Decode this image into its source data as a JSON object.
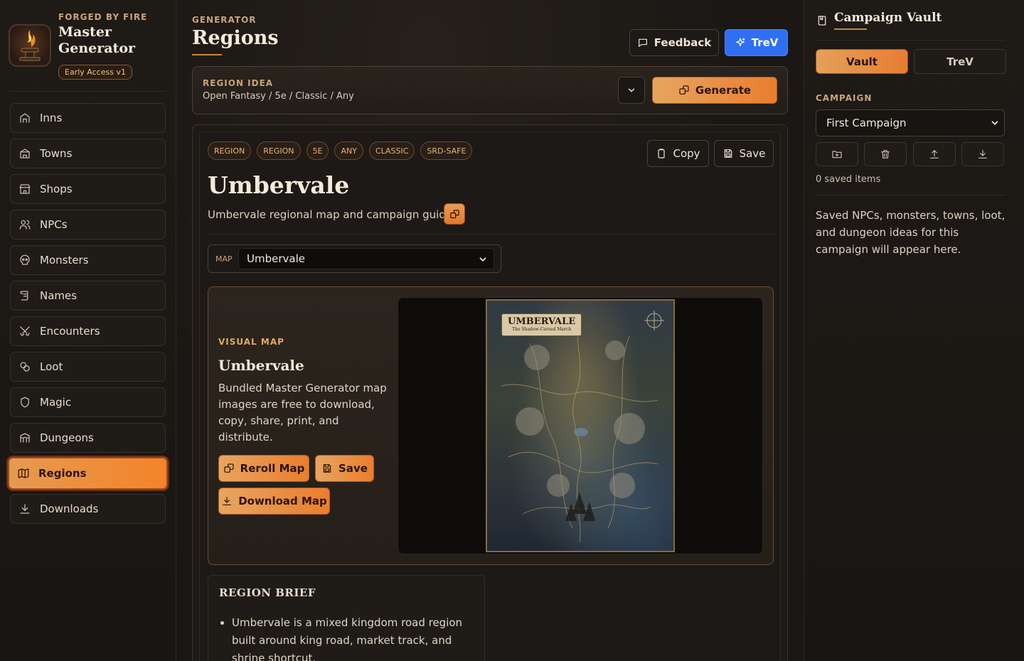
{
  "brand": {
    "tag": "FORGED BY FIRE",
    "title": "Master Generator",
    "badge": "Early Access v1"
  },
  "nav": [
    {
      "label": "Inns",
      "icon": "inn-icon"
    },
    {
      "label": "Towns",
      "icon": "town-icon"
    },
    {
      "label": "Shops",
      "icon": "shop-icon"
    },
    {
      "label": "NPCs",
      "icon": "users-icon"
    },
    {
      "label": "Monsters",
      "icon": "skull-icon"
    },
    {
      "label": "Names",
      "icon": "scroll-icon"
    },
    {
      "label": "Encounters",
      "icon": "swords-icon"
    },
    {
      "label": "Loot",
      "icon": "coins-icon"
    },
    {
      "label": "Magic",
      "icon": "shield-icon"
    },
    {
      "label": "Dungeons",
      "icon": "dungeon-icon"
    },
    {
      "label": "Regions",
      "icon": "map-icon",
      "active": true
    },
    {
      "label": "Downloads",
      "icon": "download-icon"
    }
  ],
  "header": {
    "eyebrow": "GENERATOR",
    "title": "Regions",
    "feedback_label": "Feedback",
    "trev_label": "TreV"
  },
  "idea": {
    "eyebrow": "REGION IDEA",
    "text": "Open Fantasy / 5e / Classic / Any",
    "generate_label": "Generate"
  },
  "result": {
    "chips": [
      "REGION",
      "REGION",
      "5E",
      "ANY",
      "CLASSIC",
      "SRD-SAFE"
    ],
    "copy_label": "Copy",
    "save_label": "Save",
    "title": "Umbervale",
    "subtitle": "Umbervale regional map and campaign guide",
    "map_select_label": "MAP",
    "map_select_value": "Umbervale"
  },
  "visual": {
    "eyebrow": "VISUAL MAP",
    "title": "Umbervale",
    "description": "Bundled Master Generator map images are free to download, copy, share, print, and distribute.",
    "reroll_label": "Reroll Map",
    "save_label": "Save",
    "download_label": "Download Map",
    "map_label_title": "UMBERVALE",
    "map_label_subtitle": "The Shadow-Cursed March"
  },
  "brief": {
    "title": "REGION BRIEF",
    "items": [
      "Umbervale is a mixed kingdom road region built around king road, market track, and shrine shortcut."
    ]
  },
  "vault": {
    "title": "Campaign Vault",
    "tab_vault": "Vault",
    "tab_trev": "TreV",
    "campaign_label": "CAMPAIGN",
    "campaign_value": "First Campaign",
    "saved_count": "0 saved items",
    "empty_text": "Saved NPCs, monsters, towns, loot, and dungeon ideas for this campaign will appear here."
  },
  "colors": {
    "accent": "#e8863a",
    "blue": "#2f6ff2",
    "background": "#1a1714"
  }
}
